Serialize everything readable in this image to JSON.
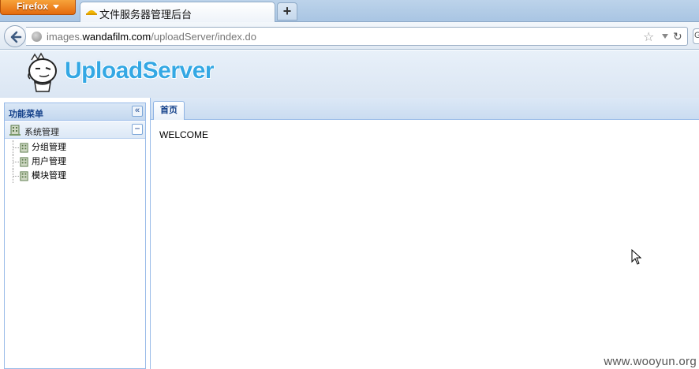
{
  "browser": {
    "menu_button": "Firefox",
    "tab_title": "文件服务器管理后台",
    "newtab_label": "+",
    "url_prefix": "images.",
    "url_domain": "wandafilm.com",
    "url_path": "/uploadServer/index.do"
  },
  "app": {
    "brand": "UploadServer",
    "sidebar": {
      "title": "功能菜单",
      "collapse_icon": "«",
      "group": {
        "title": "系统管理",
        "toggle_icon": "−",
        "items": [
          {
            "label": "分组管理"
          },
          {
            "label": "用户管理"
          },
          {
            "label": "模块管理"
          }
        ]
      }
    },
    "tabs": [
      {
        "label": "首页"
      }
    ],
    "content": {
      "welcome": "WELCOME"
    }
  },
  "watermark": "www.wooyun.org",
  "colors": {
    "brand": "#34a8e4",
    "panel_border": "#99bbe8",
    "header_text": "#15428b",
    "firefox_orange": "#e46a0d"
  }
}
